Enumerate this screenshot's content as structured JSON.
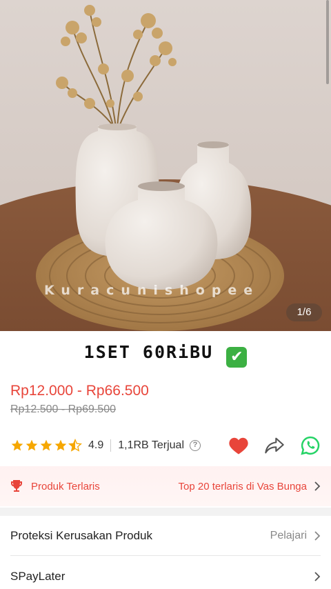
{
  "gallery": {
    "watermark": "Kuracunishopee",
    "counter": "1/6"
  },
  "promo": {
    "text": "1SET 60RiBU",
    "emoji": "✔"
  },
  "price": {
    "current": "Rp12.000 - Rp66.500",
    "original": "Rp12.500 - Rp69.500"
  },
  "rating": {
    "stars": 4.5,
    "value": "4.9",
    "sold": "1,1RB Terjual",
    "help_glyph": "?"
  },
  "icons": {
    "favorite": "heart-icon",
    "share": "share-icon",
    "whatsapp": "whatsapp-icon",
    "trophy": "trophy-icon",
    "chevron": "chevron-right-icon"
  },
  "bestseller": {
    "label": "Produk Terlaris",
    "rank": "Top 20 terlaris di Vas Bunga"
  },
  "rows": [
    {
      "label": "Proteksi Kerusakan Produk",
      "action": "Pelajari"
    },
    {
      "label": "SPayLater",
      "action": ""
    }
  ],
  "colors": {
    "accent": "#e8453a",
    "star": "#f6a700",
    "whatsapp": "#25d366",
    "heart": "#e8453a"
  }
}
